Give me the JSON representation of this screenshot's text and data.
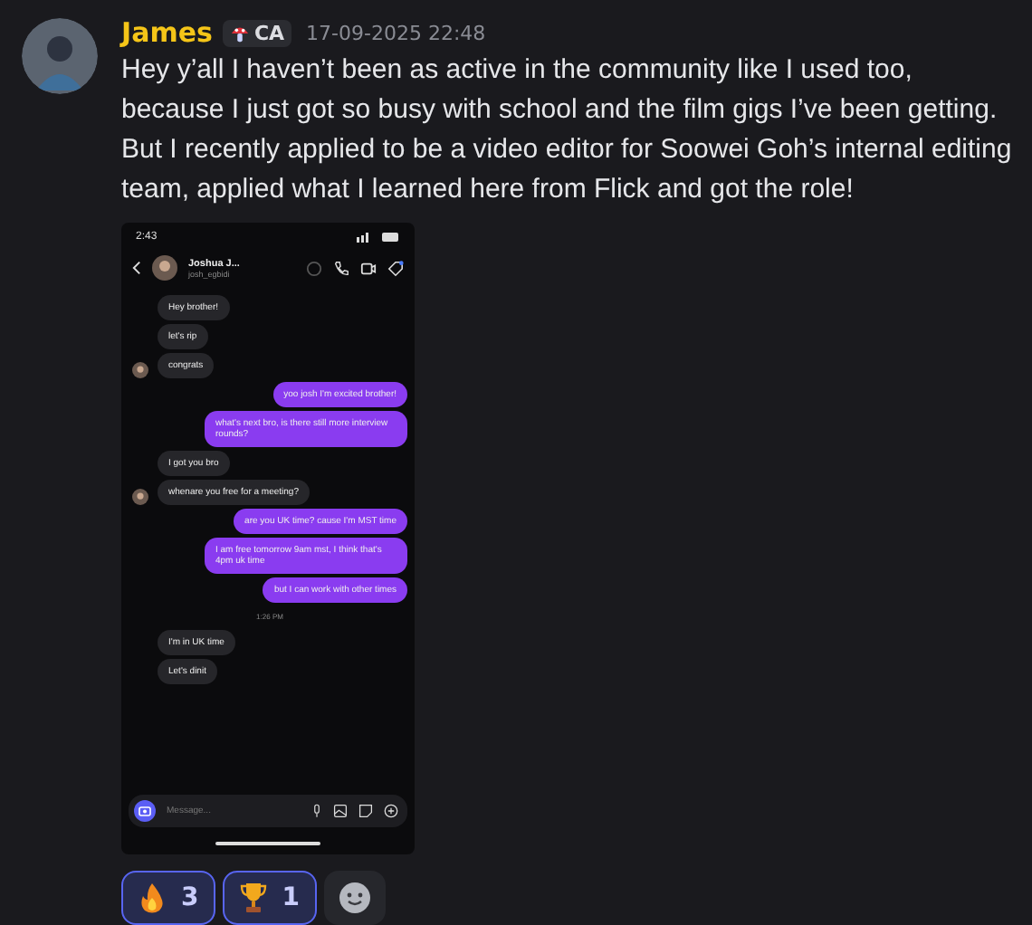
{
  "message": {
    "author": "James",
    "badge": "CA",
    "timestamp": "17-09-2025 22:48",
    "text": "Hey y’all I haven’t been as active in the community like I used too, because I just got so busy with school and the film gigs I’ve been getting. But I recently applied to be a video editor for Soowei Goh’s internal editing team, applied what I learned here from Flick and got the role!"
  },
  "screenshot": {
    "status_time": "2:43",
    "contact_name": "Joshua J...",
    "contact_handle": "josh_egbidi",
    "placeholder": "Message...",
    "messages": [
      {
        "kind": "received",
        "text": "Hey brother!",
        "avatar": false
      },
      {
        "kind": "received",
        "text": "let's rip",
        "avatar": false
      },
      {
        "kind": "received",
        "text": "congrats",
        "avatar": true
      },
      {
        "kind": "sent",
        "text": "yoo josh I'm excited brother!"
      },
      {
        "kind": "sent",
        "text": "what's next bro, is there still more interview rounds?"
      },
      {
        "kind": "received",
        "text": "I got you bro",
        "avatar": false
      },
      {
        "kind": "received",
        "text": "whenare you free for a meeting?",
        "avatar": true
      },
      {
        "kind": "sent",
        "text": "are you UK time? cause I'm MST time"
      },
      {
        "kind": "sent",
        "text": "I am free tomorrow 9am mst, I think that's 4pm uk time"
      },
      {
        "kind": "sent",
        "text": "but I can work with other times"
      },
      {
        "kind": "time",
        "text": "1:26 PM"
      },
      {
        "kind": "received",
        "text": "I'm in UK time",
        "avatar": false
      },
      {
        "kind": "received",
        "text": "Let's dinit",
        "avatar": false
      }
    ]
  },
  "reactions": [
    {
      "kind": "fire",
      "count": "3",
      "selected": true
    },
    {
      "kind": "trophy",
      "count": "1",
      "selected": true
    }
  ]
}
